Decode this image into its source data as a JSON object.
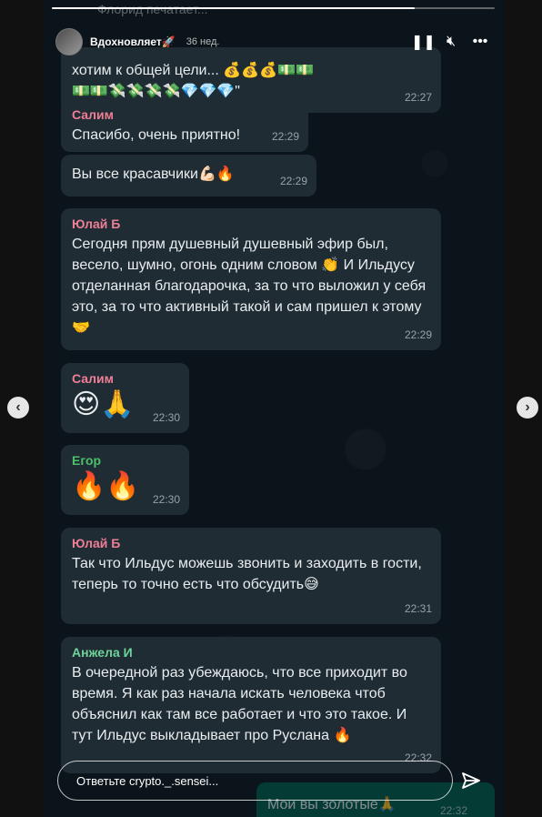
{
  "story": {
    "progress": 0.82,
    "ghost_header": "Флорид печатает...",
    "author": "Вдохновляет🚀",
    "age": "36 нед.",
    "play_icon": "pause-icon",
    "mute_icon": "mute-icon",
    "more_icon": "more-icon",
    "reply_placeholder": "Ответьте crypto._.sensei...",
    "nav_prev": "‹",
    "nav_next": "›"
  },
  "messages": [
    {
      "sender": "",
      "color": "",
      "text": "хотим к общей цели... 💰💰💰💵💵\n💵💵💸💸💸💸💎💎💎\"",
      "time": "22:27"
    },
    {
      "sender": "Салим",
      "color": "#ef7f96",
      "text": "Спасибо, очень приятно!",
      "time": "22:29"
    },
    {
      "sender": "",
      "color": "",
      "text": "Вы все красавчики💪🏻🔥",
      "time": "22:29"
    },
    {
      "sender": "Юлай Б",
      "color": "#ef7f96",
      "text": "Сегодня прям душевный душевный эфир был, весело, шумно, огонь одним словом 👏 И Ильдусу отделанная благодарочка, за то что выложил у себя это, за то что активный такой и сам пришел к этому🤝",
      "time": "22:29"
    },
    {
      "sender": "Салим",
      "color": "#ef7f96",
      "text": "😍🙏",
      "time": "22:30"
    },
    {
      "sender": "Егор",
      "color": "#4dc06a",
      "text": "🔥🔥",
      "time": "22:30"
    },
    {
      "sender": "Юлай Б",
      "color": "#ef7f96",
      "text": "Так что Ильдус можешь звонить и заходить в гости, теперь то точно есть что обсудить😅",
      "time": "22:31"
    },
    {
      "sender": "Анжела И",
      "color": "#6fd49a",
      "text": "В очередной раз убеждаюсь, что все приходит во время. Я как раз начала искать человека чтоб объяснил как там все работает и что это такое. И тут Ильдус выкладывает про Руслана 🔥",
      "time": "22:32"
    }
  ],
  "outgoing": {
    "text": "Мои вы золотые🙏",
    "time": "22:32"
  }
}
